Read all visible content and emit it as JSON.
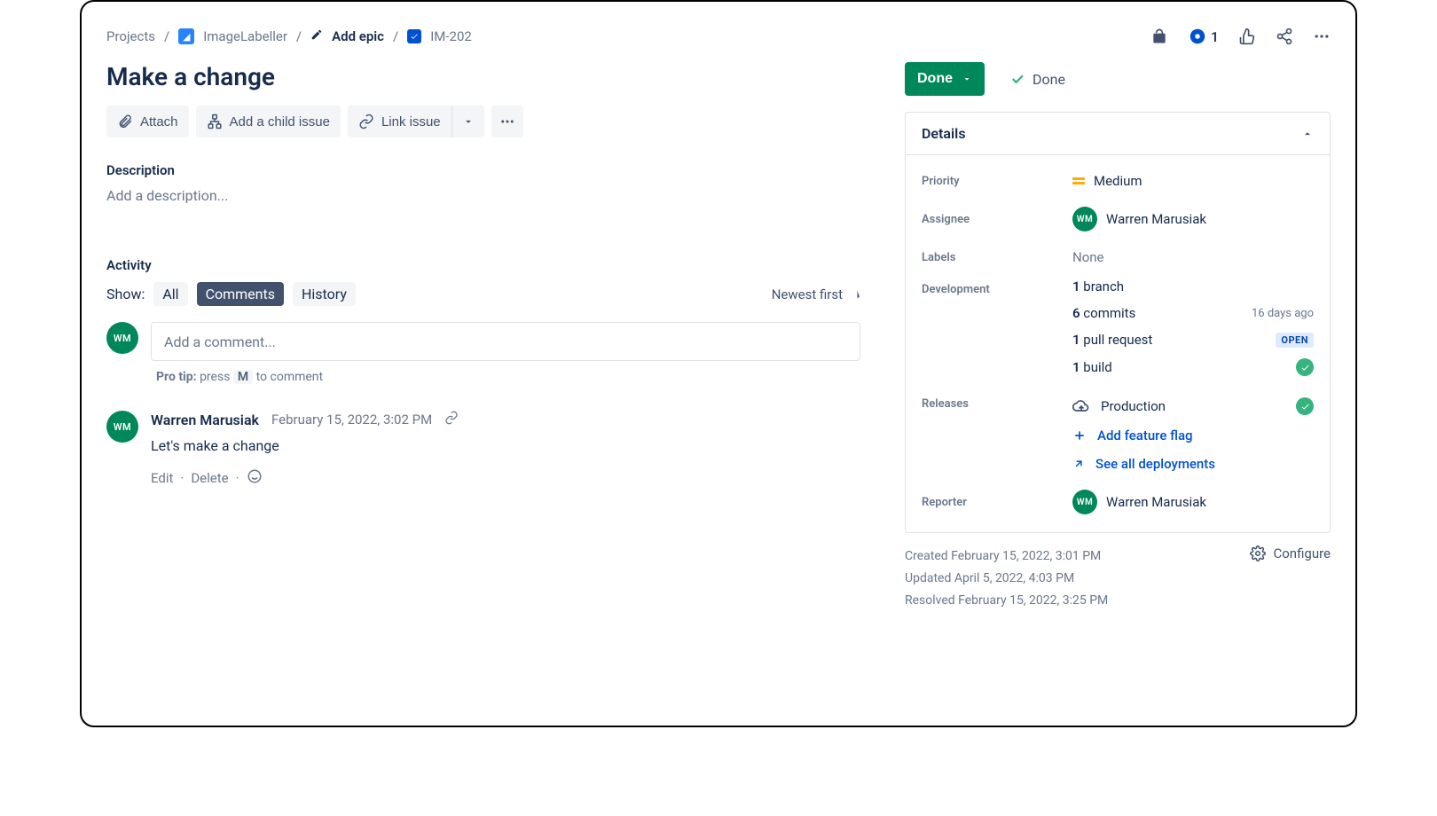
{
  "breadcrumb": {
    "projects": "Projects",
    "project_name": "ImageLabeller",
    "add_epic": "Add epic",
    "issue_key": "IM-202"
  },
  "top_actions": {
    "watch_count": "1"
  },
  "issue": {
    "title": "Make a change"
  },
  "buttons": {
    "attach": "Attach",
    "add_child": "Add a child issue",
    "link_issue": "Link issue"
  },
  "description": {
    "label": "Description",
    "placeholder": "Add a description..."
  },
  "activity": {
    "label": "Activity",
    "show": "Show:",
    "all": "All",
    "comments": "Comments",
    "history": "History",
    "sort": "Newest first"
  },
  "comment_input": {
    "placeholder": "Add a comment...",
    "protip_label": "Pro tip:",
    "protip_before": " press ",
    "protip_key": "M",
    "protip_after": " to comment"
  },
  "comment": {
    "avatar_initials": "WM",
    "author": "Warren Marusiak",
    "timestamp": "February 15, 2022, 3:02 PM",
    "text": "Let's make a change",
    "edit": "Edit",
    "delete": "Delete"
  },
  "status": {
    "button": "Done",
    "label": "Done"
  },
  "details_panel": {
    "title": "Details",
    "priority": {
      "label": "Priority",
      "value": "Medium"
    },
    "assignee": {
      "label": "Assignee",
      "initials": "WM",
      "value": "Warren Marusiak"
    },
    "labels": {
      "label": "Labels",
      "value": "None"
    },
    "development": {
      "label": "Development",
      "branch_count": "1",
      "branch_label": " branch",
      "commit_count": "6",
      "commit_label": " commits",
      "commit_age": "16 days ago",
      "pr_count": "1",
      "pr_label": " pull request",
      "pr_badge": "OPEN",
      "build_count": "1",
      "build_label": " build"
    },
    "releases": {
      "label": "Releases",
      "env": "Production",
      "add_flag": "Add feature flag",
      "see_all": "See all deployments"
    },
    "reporter": {
      "label": "Reporter",
      "initials": "WM",
      "value": "Warren Marusiak"
    }
  },
  "meta": {
    "created": "Created February 15, 2022, 3:01 PM",
    "updated": "Updated April 5, 2022, 4:03 PM",
    "resolved": "Resolved February 15, 2022, 3:25 PM",
    "configure": "Configure"
  }
}
